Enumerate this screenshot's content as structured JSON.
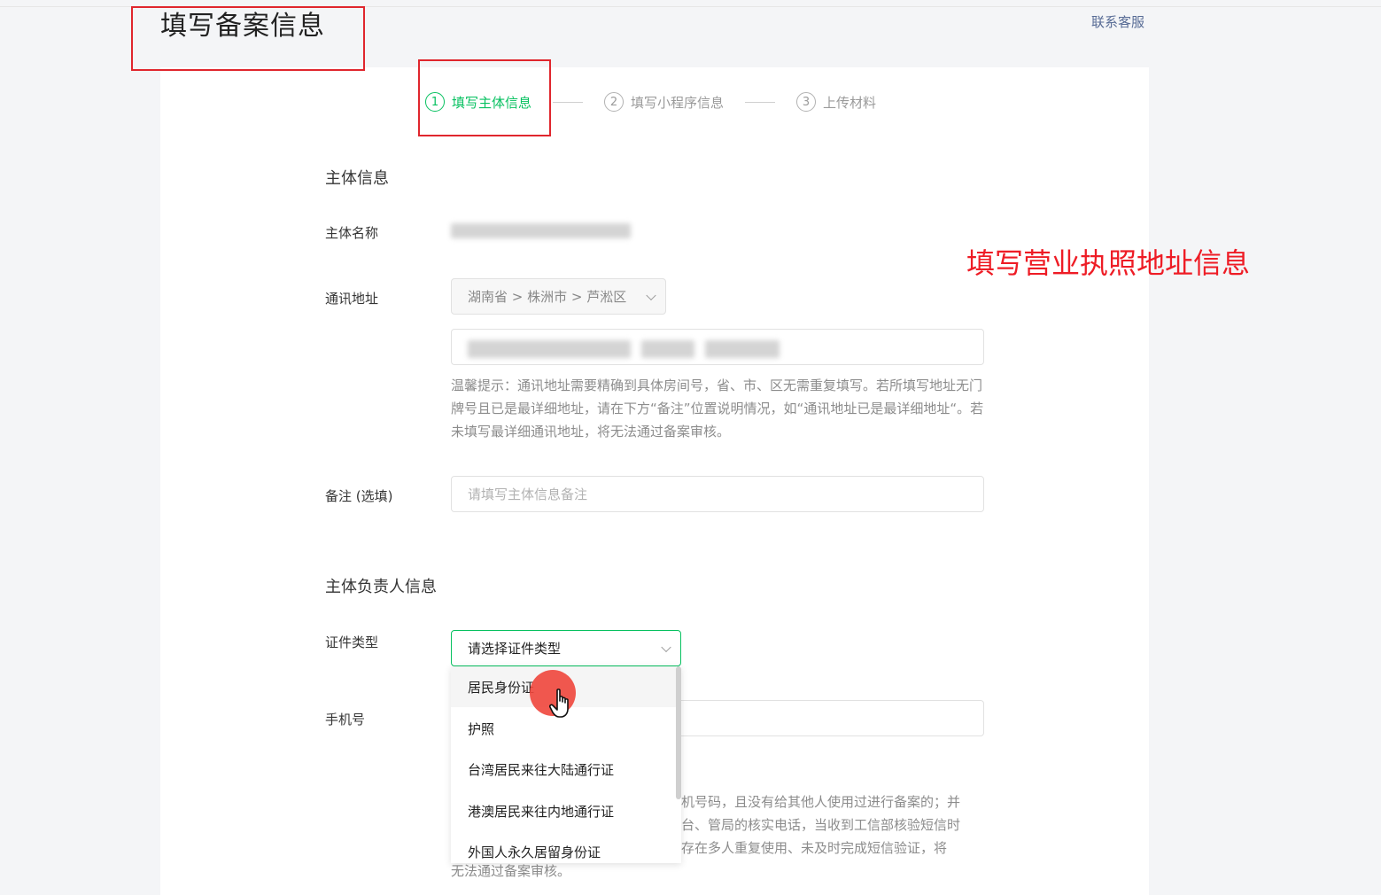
{
  "header": {
    "title": "填写备案信息",
    "contact_label": "联系客服"
  },
  "annotation": "填写营业执照地址信息",
  "steps": [
    {
      "num": "1",
      "label": "填写主体信息",
      "active": true
    },
    {
      "num": "2",
      "label": "填写小程序信息",
      "active": false
    },
    {
      "num": "3",
      "label": "上传材料",
      "active": false
    }
  ],
  "subject": {
    "section_title": "主体信息",
    "name_label": "主体名称",
    "address_label": "通讯地址",
    "address_region": "湖南省 > 株洲市 > 芦淞区",
    "address_hint": "温馨提示：通讯地址需要精确到具体房间号，省、市、区无需重复填写。若所填写地址无门牌号且已是最详细地址，请在下方“备注”位置说明情况，如“通讯地址已是最详细地址“。若未填写最详细通讯地址，将无法通过备案审核。",
    "remark_label": "备注 (选填)",
    "remark_placeholder": "请填写主体信息备注"
  },
  "principal": {
    "section_title": "主体负责人信息",
    "id_type_label": "证件类型",
    "id_type_placeholder": "请选择证件类型",
    "id_type_options": [
      "居民身份证",
      "护照",
      "台湾居民来往大陆通行证",
      "港澳居民来往内地通行证",
      "外国人永久居留身份证"
    ],
    "phone_label": "手机号",
    "phone_hint_line1": "机号码，且没有给其他人使用过进行备案的；并",
    "phone_hint_line2": "台、管局的核实电话，当收到工信部核验短信时",
    "phone_hint_line3": "存在多人重复使用、未及时完成短信验证，将",
    "phone_hint_line4": "无法通过备案审核。"
  },
  "colors": {
    "accent": "#07c160",
    "annotation_red": "#ee1c25",
    "highlight_box": "#e0262d"
  }
}
